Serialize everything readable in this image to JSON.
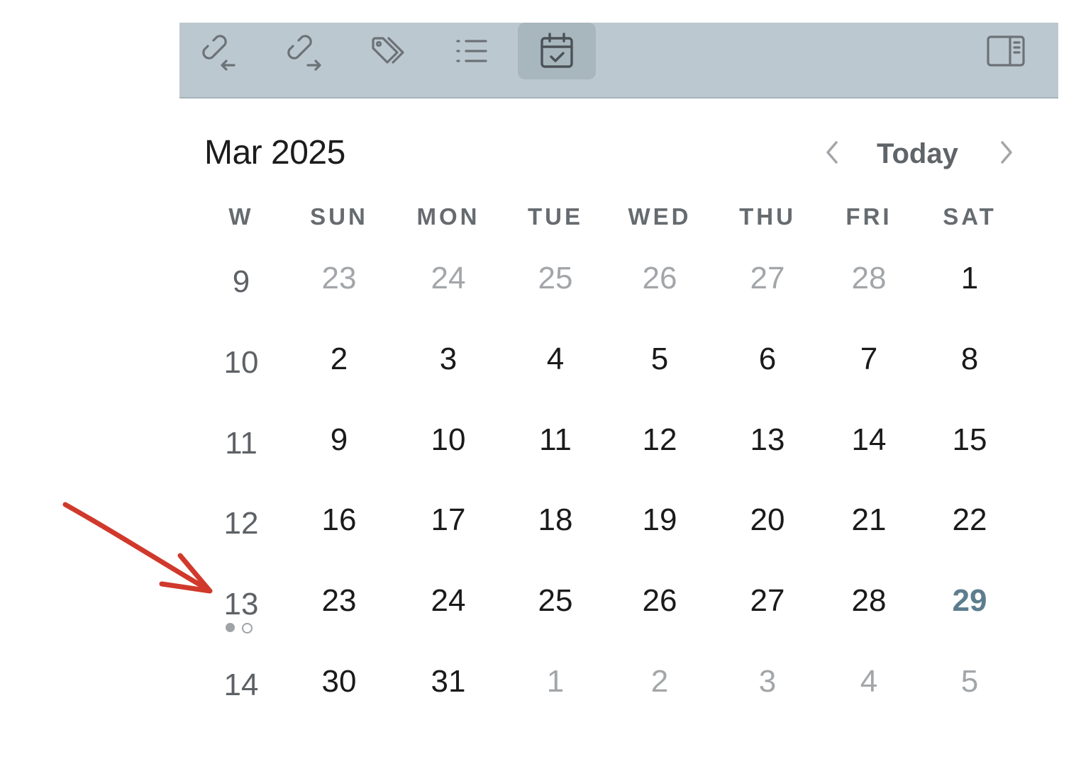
{
  "toolbar": {
    "buttons": [
      {
        "icon": "backlinks-icon",
        "active": false
      },
      {
        "icon": "outgoing-links-icon",
        "active": false
      },
      {
        "icon": "tags-icon",
        "active": false
      },
      {
        "icon": "outline-icon",
        "active": false
      },
      {
        "icon": "calendar-check-icon",
        "active": true
      },
      {
        "icon": "sidebar-toggle-icon",
        "active": false
      }
    ]
  },
  "calendar": {
    "month_label": "Mar 2025",
    "today_label": "Today",
    "weekday_headers": [
      "W",
      "SUN",
      "MON",
      "TUE",
      "WED",
      "THU",
      "FRI",
      "SAT"
    ],
    "weeks": [
      {
        "week": "9",
        "days": [
          "23",
          "24",
          "25",
          "26",
          "27",
          "28",
          "1"
        ]
      },
      {
        "week": "10",
        "days": [
          "2",
          "3",
          "4",
          "5",
          "6",
          "7",
          "8"
        ]
      },
      {
        "week": "11",
        "days": [
          "9",
          "10",
          "11",
          "12",
          "13",
          "14",
          "15"
        ]
      },
      {
        "week": "12",
        "days": [
          "16",
          "17",
          "18",
          "19",
          "20",
          "21",
          "22"
        ]
      },
      {
        "week": "13",
        "days": [
          "23",
          "24",
          "25",
          "26",
          "27",
          "28",
          "29"
        ]
      },
      {
        "week": "14",
        "days": [
          "30",
          "31",
          "1",
          "2",
          "3",
          "4",
          "5"
        ]
      }
    ],
    "today": "29",
    "accent_color": "#5d7d8e",
    "annotation_color": "#d0392b"
  }
}
